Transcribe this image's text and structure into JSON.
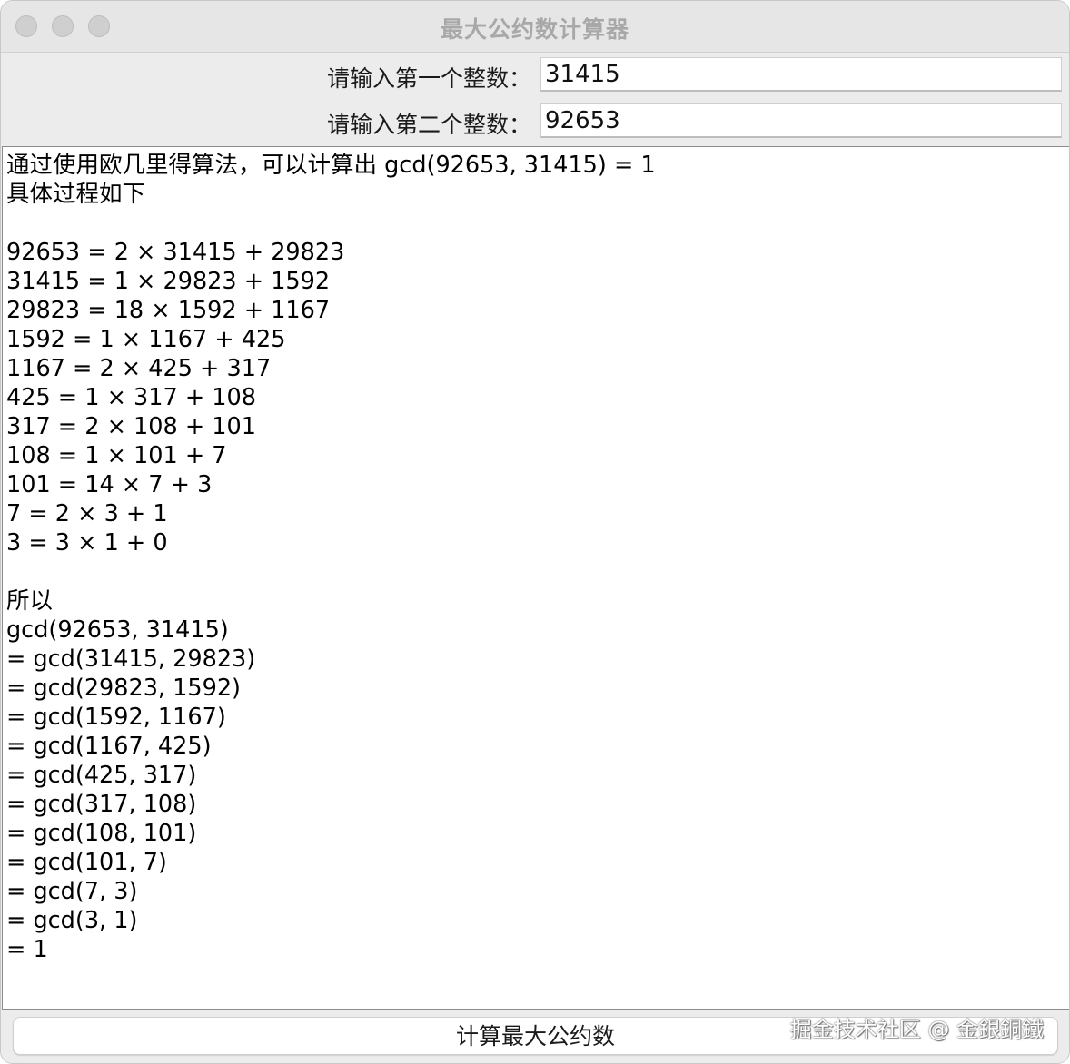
{
  "window": {
    "title": "最大公约数计算器"
  },
  "form": {
    "first_label": "请输入第一个整数：",
    "first_value": "31415",
    "second_label": "请输入第二个整数：",
    "second_value": "92653"
  },
  "output": {
    "lines": [
      "通过使用欧几里得算法，可以计算出 gcd(92653, 31415) = 1",
      "具体过程如下",
      "",
      "92653 = 2 × 31415 + 29823",
      "31415 = 1 × 29823 + 1592",
      "29823 = 18 × 1592 + 1167",
      "1592 = 1 × 1167 + 425",
      "1167 = 2 × 425 + 317",
      "425 = 1 × 317 + 108",
      "317 = 2 × 108 + 101",
      "108 = 1 × 101 + 7",
      "101 = 14 × 7 + 3",
      "7 = 2 × 3 + 1",
      "3 = 3 × 1 + 0",
      "",
      "所以",
      "gcd(92653, 31415)",
      "= gcd(31415, 29823)",
      "= gcd(29823, 1592)",
      "= gcd(1592, 1167)",
      "= gcd(1167, 425)",
      "= gcd(425, 317)",
      "= gcd(317, 108)",
      "= gcd(108, 101)",
      "= gcd(101, 7)",
      "= gcd(7, 3)",
      "= gcd(3, 1)",
      "= 1"
    ]
  },
  "actions": {
    "calculate_label": "计算最大公约数"
  },
  "watermark": {
    "text": "掘金技术社区 @ 金銀銅鐵"
  }
}
